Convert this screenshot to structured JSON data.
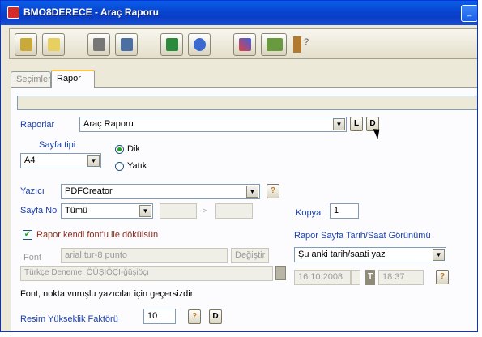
{
  "window": {
    "title": "BMO8DERECE - Araç Raporu"
  },
  "toolbar": {
    "icons": [
      "book-icon",
      "document-icon",
      "printer-icon",
      "tree-icon",
      "excel-icon",
      "clock-icon",
      "paint-icon",
      "chart-icon",
      "figure-icon",
      "help-icon"
    ],
    "help_text": "?"
  },
  "tabs": [
    {
      "label": "Seçimler"
    },
    {
      "label": "Rapor"
    }
  ],
  "report": {
    "raporlar_label": "Raporlar",
    "raporlar_value": "Araç Raporu",
    "btn_l": "L",
    "btn_d": "D",
    "sayfa_tipi_label": "Sayfa tipi",
    "sayfa_tipi_value": "A4",
    "orientation": {
      "dik": "Dik",
      "yatik": "Yatık",
      "selected": "Dik"
    },
    "yazici_label": "Yazıcı",
    "yazici_value": "PDFCreator",
    "help": "?",
    "sayfa_no_label": "Sayfa No",
    "sayfa_no_value": "Tümü",
    "range_sep": "->",
    "kopya_label": "Kopya",
    "kopya_value": "1",
    "font_checkbox_label": "Rapor kendi font'u ile dökülsün",
    "font_label": "Font",
    "font_value": "arial tur-8 punto",
    "degistir_label": "Değiştir",
    "font_preview": "Türkçe Deneme: ÖÜŞIÖÇI-ğüşiöçı",
    "date_header": "Rapor Sayfa Tarih/Saat Görünümü",
    "date_mode_value": "Şu anki tarih/saati yaz",
    "date_value": "16.10.2008",
    "time_value": "18:37",
    "t_btn": "T",
    "font_note": "Font, nokta vuruşlu yazıcılar için geçersizdir",
    "resim_label": "Resim Yükseklik Faktörü",
    "resim_value": "10"
  }
}
